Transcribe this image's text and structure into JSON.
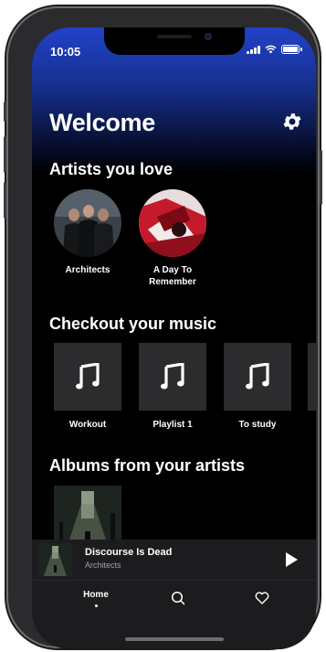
{
  "status_bar": {
    "time": "10:05"
  },
  "header": {
    "title": "Welcome",
    "settings_icon": "gear-icon"
  },
  "artists_section": {
    "title": "Artists you love",
    "items": [
      {
        "name": "Architects"
      },
      {
        "name": "A Day To Remember"
      }
    ]
  },
  "music_section": {
    "title": "Checkout your music",
    "playlists": [
      {
        "name": "Workout",
        "icon": "music-note-icon"
      },
      {
        "name": "Playlist 1",
        "icon": "music-note-icon"
      },
      {
        "name": "To study",
        "icon": "music-note-icon"
      }
    ]
  },
  "albums_section": {
    "title": "Albums from your artists"
  },
  "now_playing": {
    "title": "Discourse Is Dead",
    "artist": "Architects",
    "control_icon": "play-icon"
  },
  "tab_bar": {
    "tabs": [
      {
        "label": "Home",
        "icon": "",
        "active": true
      },
      {
        "label": "",
        "icon": "search-icon",
        "active": false
      },
      {
        "label": "",
        "icon": "heart-icon",
        "active": false
      }
    ]
  },
  "colors": {
    "hero_gradient_top": "#2142c7",
    "background": "#000000",
    "tile": "#2c2c2e"
  }
}
